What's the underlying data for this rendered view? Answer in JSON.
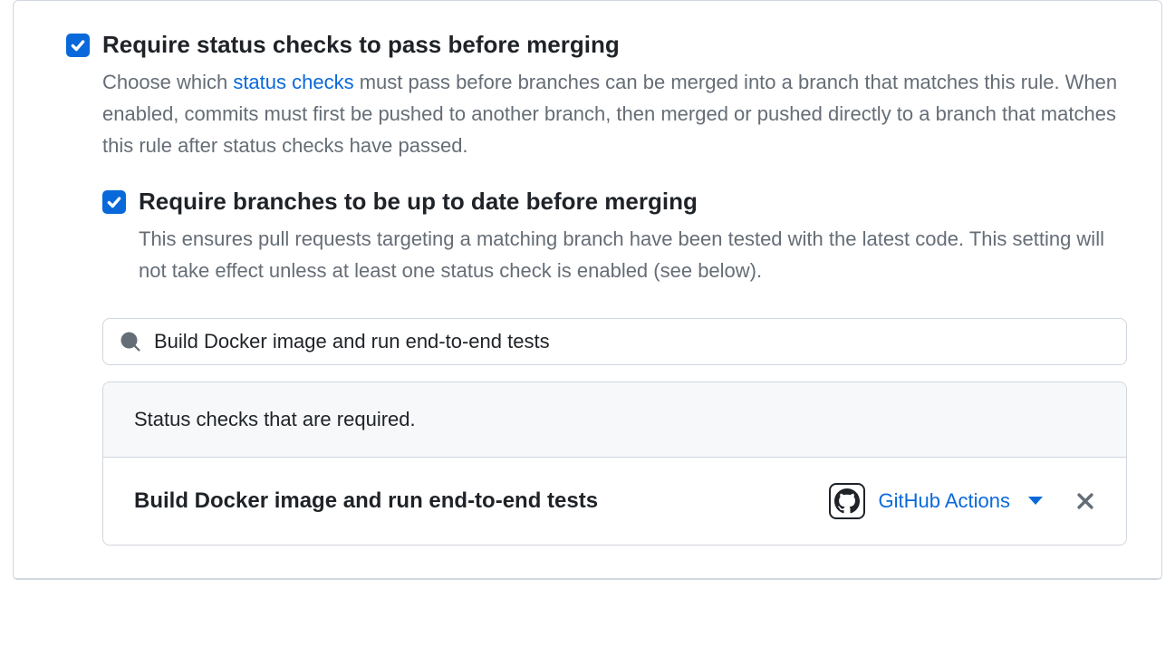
{
  "ruleSection": {
    "requireStatusChecks": {
      "checked": true,
      "title": "Require status checks to pass before merging",
      "descPrefix": "Choose which ",
      "descLinkText": "status checks",
      "descSuffix": " must pass before branches can be merged into a branch that matches this rule. When enabled, commits must first be pushed to another branch, then merged or pushed directly to a branch that matches this rule after status checks have passed."
    },
    "requireUpToDate": {
      "checked": true,
      "title": "Require branches to be up to date before merging",
      "desc": "This ensures pull requests targeting a matching branch have been tested with the latest code. This setting will not take effect unless at least one status check is enabled (see below)."
    },
    "search": {
      "value": "Build Docker image and run end-to-end tests"
    },
    "requiredChecks": {
      "header": "Status checks that are required.",
      "items": [
        {
          "name": "Build Docker image and run end-to-end tests",
          "app": "GitHub Actions"
        }
      ]
    }
  }
}
